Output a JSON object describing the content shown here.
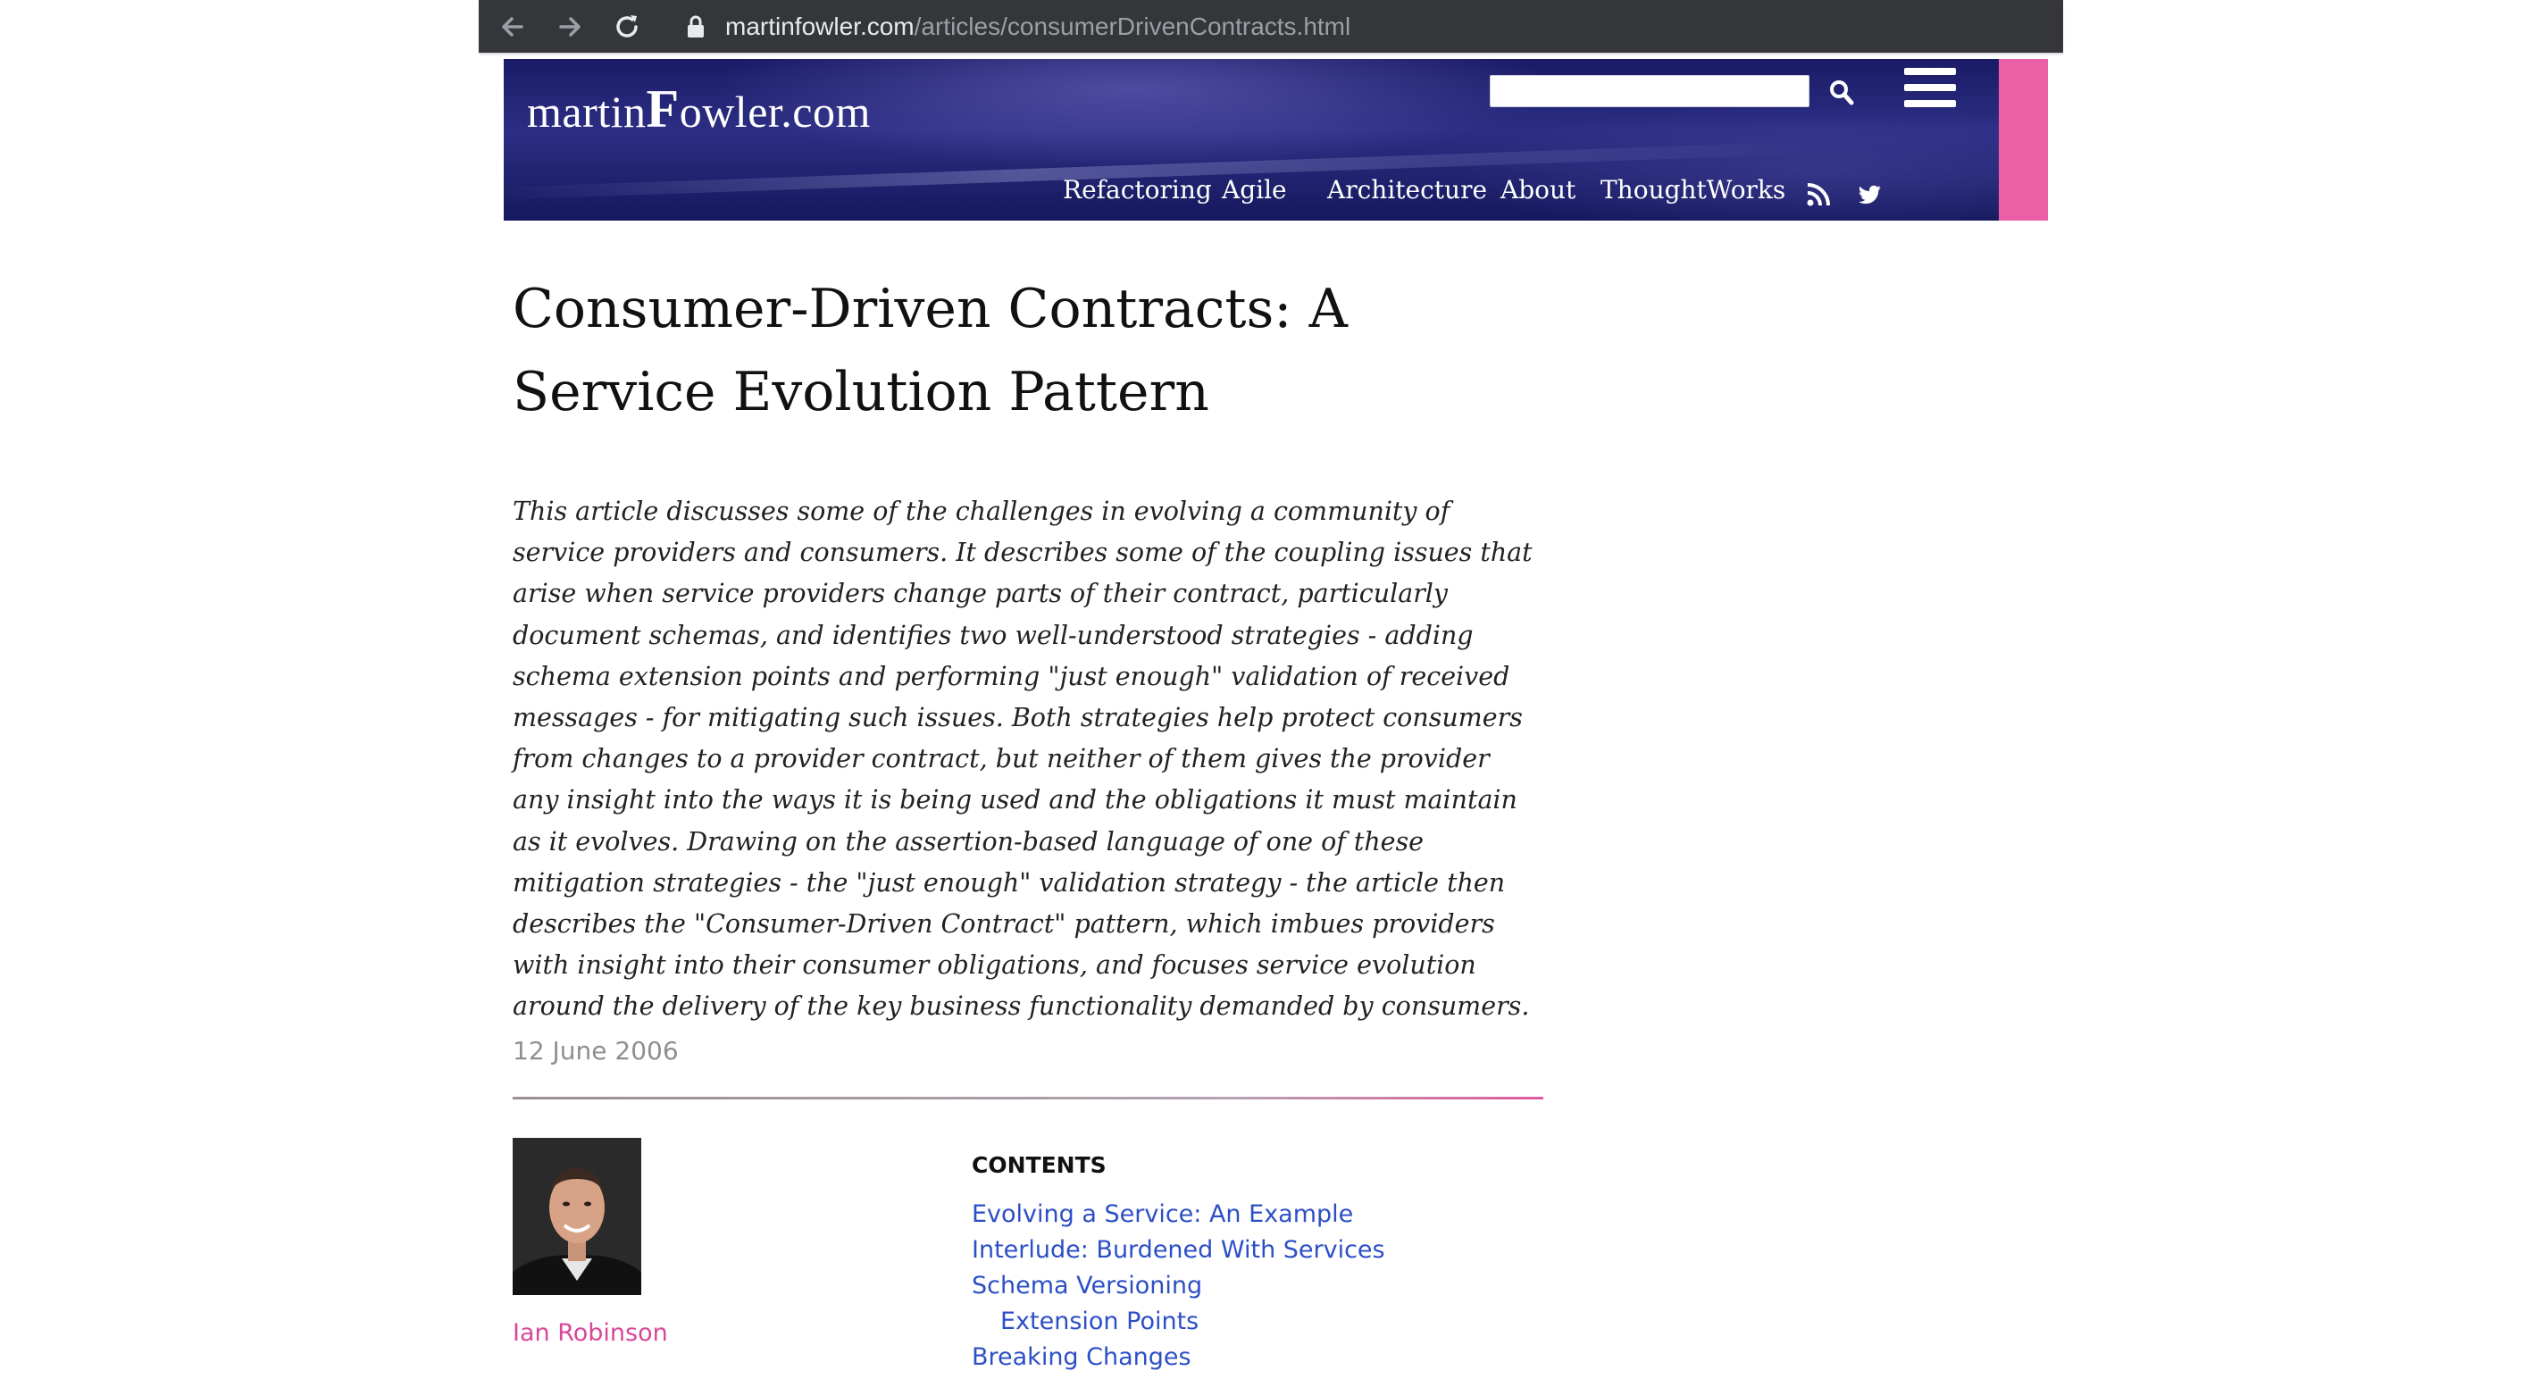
{
  "browser": {
    "url_domain": "martinfowler.com",
    "url_path": "/articles/consumerDrivenContracts.html",
    "back_icon": "arrow-left-icon",
    "forward_icon": "arrow-right-icon",
    "reload_icon": "reload-icon",
    "lock_icon": "lock-icon"
  },
  "site": {
    "logo_pre": "martin",
    "logo_big": "F",
    "logo_post": "owler.com",
    "search_value": "",
    "nav": [
      "Refactoring",
      "Agile",
      "Architecture",
      "About",
      "ThoughtWorks"
    ],
    "accent_color": "#ea5fa6"
  },
  "article": {
    "title": "Consumer-Driven Contracts: A Service Evolution Pattern",
    "abstract": "This article discusses some of the challenges in evolving a community of service providers and consumers. It describes some of the coupling issues that arise when service providers change parts of their contract, particularly document schemas, and identifies two well-understood strategies - adding schema extension points and performing \"just enough\" validation of received messages - for mitigating such issues. Both strategies help protect consumers from changes to a provider contract, but neither of them gives the provider any insight into the ways it is being used and the obligations it must maintain as it evolves. Drawing on the assertion-based language of one of these mitigation strategies - the \"just enough\" validation strategy - the article then describes the \"Consumer-Driven Contract\" pattern, which imbues providers with insight into their consumer obligations, and focuses service evolution around the delivery of the key business functionality demanded by consumers.",
    "date": "12 June 2006",
    "author": "Ian Robinson"
  },
  "contents": {
    "heading": "CONTENTS",
    "items": [
      {
        "label": "Evolving a Service: An Example",
        "sub": false
      },
      {
        "label": "Interlude: Burdened With Services",
        "sub": false
      },
      {
        "label": "Schema Versioning",
        "sub": false
      },
      {
        "label": "Extension Points",
        "sub": true
      },
      {
        "label": "Breaking Changes",
        "sub": false
      }
    ]
  }
}
